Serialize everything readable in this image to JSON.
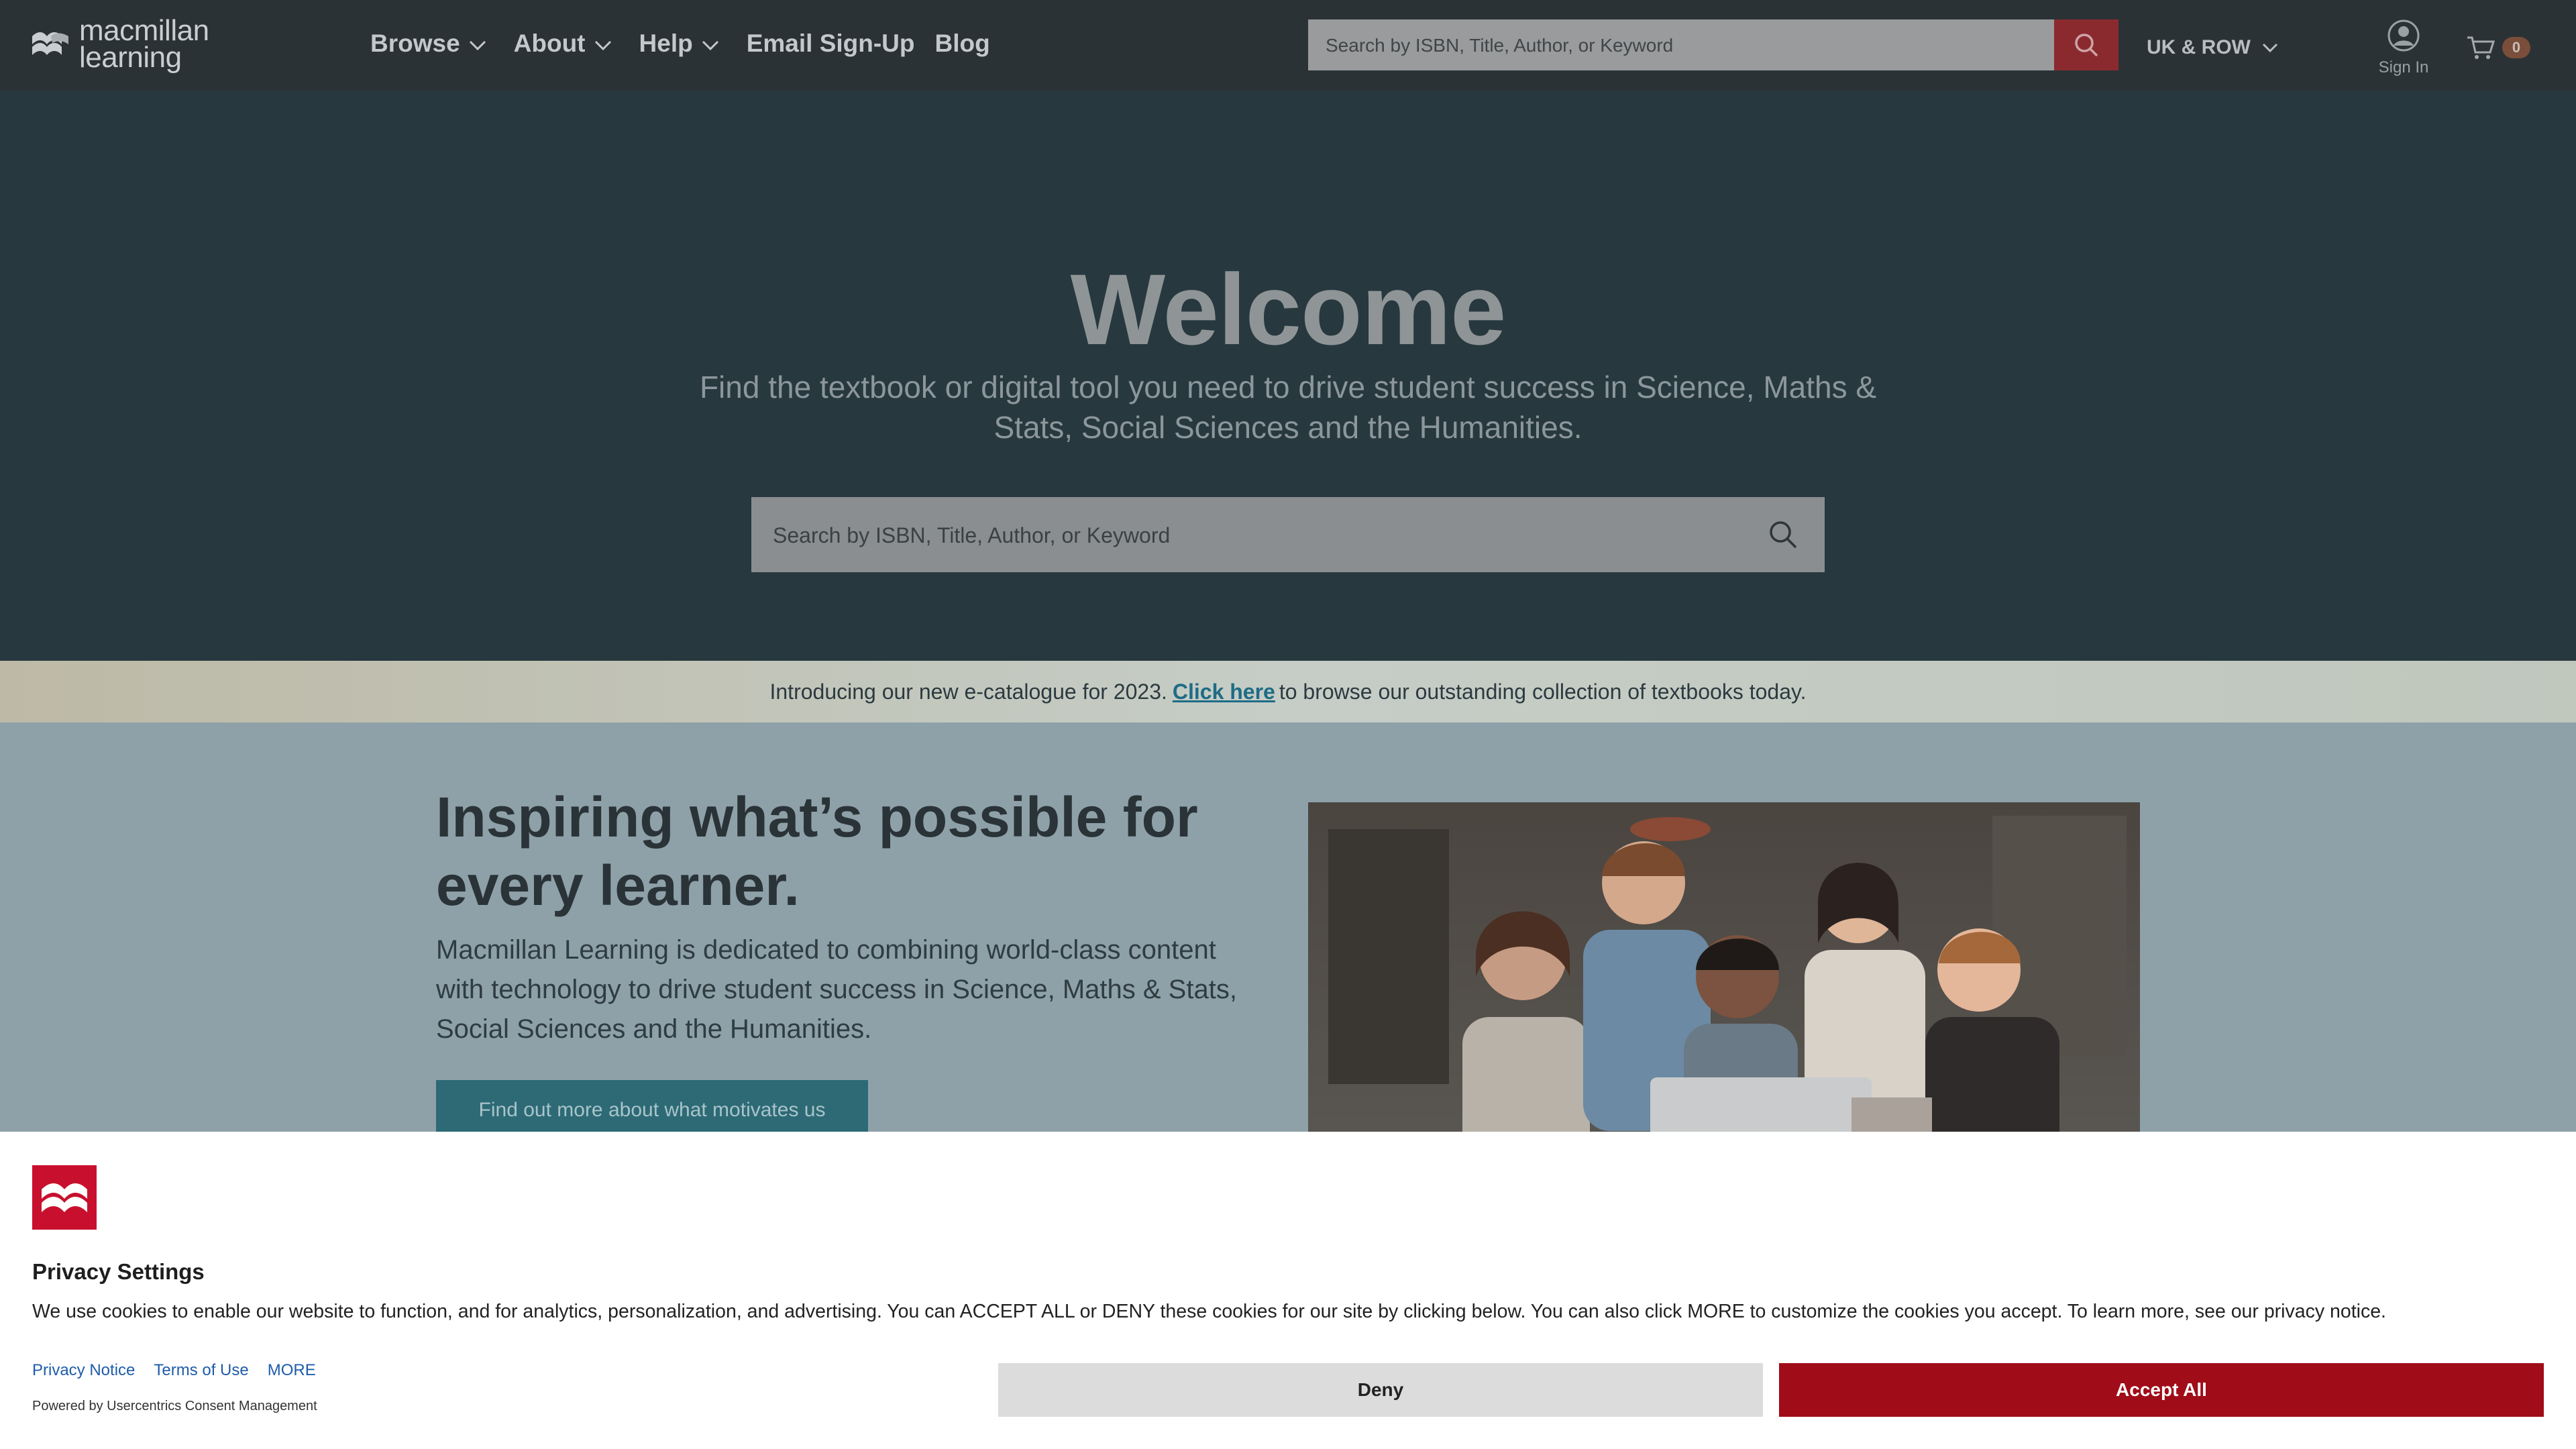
{
  "colors": {
    "header_bg": "#2b3235",
    "hero_bg": "#27383f",
    "accent_red": "#a00c18",
    "teal_button": "#2d6a76",
    "link_blue": "#1f6c86"
  },
  "header": {
    "logo_lines": [
      "macmillan",
      "learning"
    ],
    "nav": [
      {
        "label": "Browse",
        "has_dropdown": true
      },
      {
        "label": "About",
        "has_dropdown": true
      },
      {
        "label": "Help",
        "has_dropdown": true
      },
      {
        "label": "Email Sign-Up",
        "has_dropdown": false
      },
      {
        "label": "Blog",
        "has_dropdown": false
      }
    ],
    "search_placeholder": "Search by ISBN, Title, Author, or Keyword",
    "search_icon": "search-icon",
    "region": "UK & ROW",
    "signin_label": "Sign In",
    "cart_count": "0"
  },
  "hero": {
    "title": "Welcome",
    "subtitle": "Find the textbook or digital tool you need to drive student success in Science, Maths & Stats, Social Sciences and the Humanities.",
    "search_placeholder": "Search by ISBN, Title, Author, or Keyword"
  },
  "banner": {
    "text_before": "Introducing our new e-catalogue for 2023.",
    "link_text": "Click here",
    "text_after": "to browse our outstanding collection of textbooks today."
  },
  "content": {
    "title": "Inspiring what’s possible for every learner.",
    "body": "Macmillan Learning is dedicated to combining world-class content with technology to drive student success in Science, Maths & Stats, Social Sciences and the Humanities.",
    "button_label": "Find out more about what motivates us"
  },
  "cookie": {
    "title": "Privacy Settings",
    "text": "We use cookies to enable our website to function, and for analytics, personalization, and advertising. You can ACCEPT ALL or DENY these cookies for our site by clicking below. You can also click MORE to customize the cookies you accept. To learn more, see our privacy notice.",
    "links": [
      "Privacy Notice",
      "Terms of Use",
      "MORE"
    ],
    "powered_by": "Powered by Usercentrics Consent Management",
    "deny_label": "Deny",
    "accept_label": "Accept All"
  }
}
